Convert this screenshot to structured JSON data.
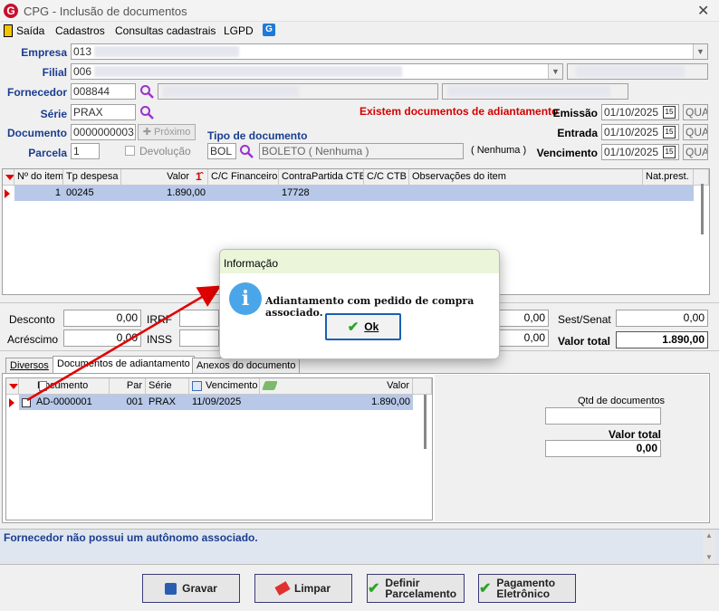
{
  "window": {
    "title": "CPG - Inclusão de documentos",
    "logo_letter": "G"
  },
  "menu": {
    "items": [
      "Saída",
      "Cadastros",
      "Consultas cadastrais",
      "LGPD"
    ]
  },
  "header": {
    "empresa_label": "Empresa",
    "empresa_code": "013",
    "filial_label": "Filial",
    "filial_code": "006",
    "fornecedor_label": "Fornecedor",
    "fornecedor_code": "008844",
    "serie_label": "Série",
    "serie_value": "PRAX",
    "documento_label": "Documento",
    "documento_value": "0000000003",
    "proximo_label": "Próximo",
    "parcela_label": "Parcela",
    "parcela_value": "1",
    "devolucao_label": "Devolução",
    "tipo_doc_label": "Tipo de documento",
    "tipo_doc_code": "BOL",
    "tipo_doc_desc": "BOLETO ( Nenhuma )",
    "tipo_doc_extra": "( Nenhuma )",
    "adiantamento_warning": "Existem documentos de adiantamento",
    "emissao_label": "Emissão",
    "emissao_value": "01/10/2025",
    "emissao_day": "QUA",
    "entrada_label": "Entrada",
    "entrada_value": "01/10/2025",
    "entrada_day": "QUA",
    "vencimento_label": "Vencimento",
    "vencimento_value": "01/10/2025",
    "vencimento_day": "QUA"
  },
  "items_grid": {
    "columns": [
      "Nº do item",
      "Tp despesa",
      "Valor",
      "C/C Financeiro",
      "ContraPartida CTB",
      "C/C CTB",
      "Observações do item",
      "Nat.prest."
    ],
    "rows": [
      {
        "item": "1",
        "tp": "00245",
        "valor": "1.890,00",
        "cc_fin": "",
        "contra": "17728",
        "cc_ctb": "",
        "obs": "",
        "nat": ""
      }
    ]
  },
  "totals": {
    "desconto_label": "Desconto",
    "desconto_value": "0,00",
    "acrescimo_label": "Acréscimo",
    "acrescimo_value": "0,00",
    "irrf_label": "IRRF",
    "inss_label": "INSS",
    "mid_value1": "0,00",
    "mid_value2": "0,00",
    "sest_label": "Sest/Senat",
    "sest_value": "0,00",
    "valor_total_label": "Valor total",
    "valor_total_value": "1.890,00"
  },
  "tabs": [
    "Diversos",
    "Documentos de adiantamento",
    "Anexos do documento"
  ],
  "adv_grid": {
    "columns": [
      "Documento",
      "Par",
      "Série",
      "Vencimento",
      "Valor"
    ],
    "rows": [
      {
        "doc": "AD-0000001",
        "par": "001",
        "serie": "PRAX",
        "venc": "11/09/2025",
        "valor": "1.890,00"
      }
    ]
  },
  "adv_summary": {
    "qtd_label": "Qtd de documentos",
    "qtd_value": "",
    "total_label": "Valor total",
    "total_value": "0,00"
  },
  "status_message": "Fornecedor não possui um autônomo associado.",
  "buttons": {
    "gravar": "Gravar",
    "limpar": "Limpar",
    "definir": "Definir Parcelamento",
    "pagamento": "Pagamento Eletrônico"
  },
  "dialog": {
    "title": "Informação",
    "message": "Adiantamento com pedido de compra associado.",
    "ok": "Ok"
  },
  "colors": {
    "label_blue": "#1a3d8f",
    "warning_red": "#d40000",
    "selected_row": "#b8c8e8",
    "dialog_title_bg": "#eaf5da"
  }
}
